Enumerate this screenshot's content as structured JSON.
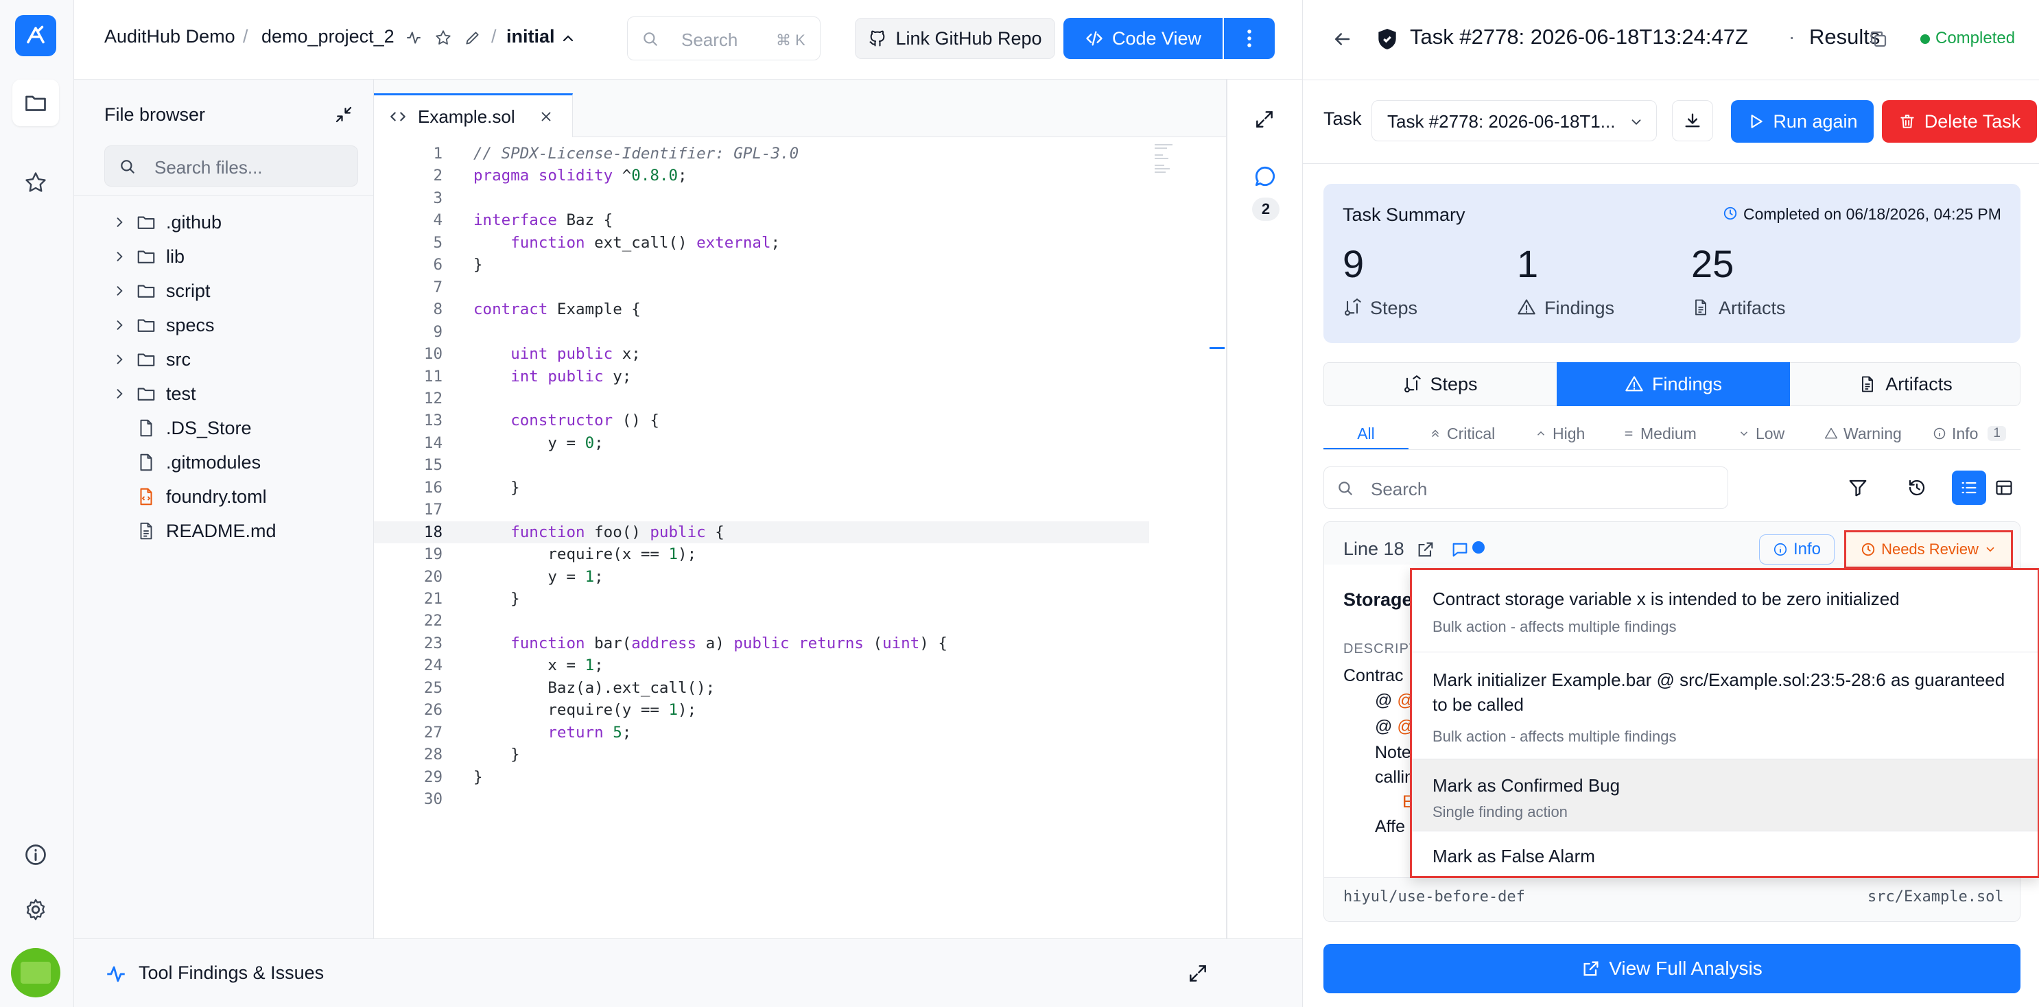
{
  "header": {
    "org": "AuditHub Demo",
    "project": "demo_project_2",
    "version": "initial",
    "search_placeholder": "Search",
    "search_shortcut": "⌘ K",
    "link_github_label": "Link GitHub Repo",
    "code_view_label": "Code View"
  },
  "file_browser": {
    "title": "File browser",
    "search_placeholder": "Search files...",
    "folders": [
      ".github",
      "lib",
      "script",
      "specs",
      "src",
      "test"
    ],
    "files": [
      ".DS_Store",
      ".gitmodules",
      "foundry.toml",
      "README.md"
    ]
  },
  "editor": {
    "tab_name": "Example.sol",
    "comment_count": "2",
    "lines": [
      "// SPDX-License-Identifier: GPL-3.0",
      "pragma solidity ^0.8.0;",
      "",
      "interface Baz {",
      "    function ext_call() external;",
      "}",
      "",
      "contract Example {",
      "",
      "    uint public x;",
      "    int public y;",
      "",
      "    constructor () {",
      "        y = 0;",
      "",
      "    }",
      "",
      "    function foo() public {",
      "        require(x == 1);",
      "        y = 1;",
      "    }",
      "",
      "    function bar(address a) public returns (uint) {",
      "        x = 1;",
      "        Baz(a).ext_call();",
      "        require(y == 1);",
      "        return 5;",
      "    }",
      "}",
      ""
    ],
    "highlighted_line": 18
  },
  "bottom_bar": {
    "label": "Tool Findings & Issues"
  },
  "task": {
    "header_title": "Task #2778: 2026-06-18T13:24:47Z",
    "header_sep": "·",
    "header_results": "Results",
    "status": "Completed",
    "label": "Task",
    "select_value": "Task #2778: 2026-06-18T1...",
    "run_again_label": "Run again",
    "delete_label": "Delete Task",
    "summary": {
      "title": "Task Summary",
      "completed_on": "Completed on 06/18/2026, 04:25 PM",
      "steps_count": "9",
      "steps_label": "Steps",
      "findings_count": "1",
      "findings_label": "Findings",
      "artifacts_count": "25",
      "artifacts_label": "Artifacts"
    },
    "tabs": [
      "Steps",
      "Findings",
      "Artifacts"
    ],
    "severity_tabs": [
      "All",
      "Critical",
      "High",
      "Medium",
      "Low",
      "Warning",
      "Info"
    ],
    "info_count": "1",
    "search_placeholder": "Search"
  },
  "finding": {
    "line_label": "Line 18",
    "severity": "Info",
    "status": "Needs Review",
    "title_partial": "Storage",
    "desc_label": "DESCRIPT",
    "desc_lines": [
      "Contrac",
      "@ Ex",
      "@ Ex",
      "Note",
      "callin",
      "E",
      "Affe"
    ],
    "footer_rule": "hiyul/use-before-def",
    "footer_file": "src/Example.sol"
  },
  "dropdown": {
    "items": [
      {
        "title": "Contract storage variable x is intended to be zero initialized",
        "sub": "Bulk action - affects multiple findings"
      },
      {
        "title": "Mark initializer Example.bar @ src/Example.sol:23:5-28:6 as guaranteed to be called",
        "sub": "Bulk action - affects multiple findings"
      },
      {
        "title": "Mark as Confirmed Bug",
        "sub": "Single finding action"
      },
      {
        "title": "Mark as False Alarm",
        "sub": ""
      }
    ]
  },
  "view_full_label": "View Full Analysis",
  "colors": {
    "primary": "#1677ff",
    "danger": "#ef2b2d",
    "completed": "#16a34a",
    "needs_review": "#ea580c",
    "highlight_red": "#e53935",
    "summary_bg": "#e5ecfb"
  }
}
